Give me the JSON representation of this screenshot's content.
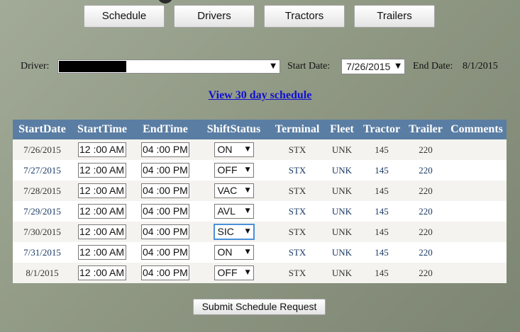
{
  "nav": {
    "buttons": [
      "Schedule",
      "Drivers",
      "Tractors",
      "Trailers"
    ]
  },
  "filters": {
    "driver_label": "Driver:",
    "driver_value": "",
    "start_label": "Start Date:",
    "start_value": "7/26/2015",
    "end_label": "End Date:",
    "end_value": "8/1/2015"
  },
  "link": "View 30 day schedule",
  "table": {
    "headers": [
      "StartDate",
      "StartTime",
      "EndTime",
      "ShiftStatus",
      "Terminal",
      "Fleet",
      "Tractor",
      "Trailer",
      "Comments"
    ],
    "rows": [
      {
        "date": "7/26/2015",
        "start": "12 :00 AM",
        "end": "04 :00 PM",
        "status": "ON",
        "terminal": "STX",
        "fleet": "UNK",
        "tractor": "145",
        "trailer": "220",
        "comments": ""
      },
      {
        "date": "7/27/2015",
        "start": "12 :00 AM",
        "end": "04 :00 PM",
        "status": "OFF",
        "terminal": "STX",
        "fleet": "UNK",
        "tractor": "145",
        "trailer": "220",
        "comments": ""
      },
      {
        "date": "7/28/2015",
        "start": "12 :00 AM",
        "end": "04 :00 PM",
        "status": "VAC",
        "terminal": "STX",
        "fleet": "UNK",
        "tractor": "145",
        "trailer": "220",
        "comments": ""
      },
      {
        "date": "7/29/2015",
        "start": "12 :00 AM",
        "end": "04 :00 PM",
        "status": "AVL",
        "terminal": "STX",
        "fleet": "UNK",
        "tractor": "145",
        "trailer": "220",
        "comments": ""
      },
      {
        "date": "7/30/2015",
        "start": "12 :00 AM",
        "end": "04 :00 PM",
        "status": "SIC",
        "terminal": "STX",
        "fleet": "UNK",
        "tractor": "145",
        "trailer": "220",
        "comments": ""
      },
      {
        "date": "7/31/2015",
        "start": "12 :00 AM",
        "end": "04 :00 PM",
        "status": "ON",
        "terminal": "STX",
        "fleet": "UNK",
        "tractor": "145",
        "trailer": "220",
        "comments": ""
      },
      {
        "date": "8/1/2015",
        "start": "12 :00 AM",
        "end": "04 :00 PM",
        "status": "OFF",
        "terminal": "STX",
        "fleet": "UNK",
        "tractor": "145",
        "trailer": "220",
        "comments": ""
      }
    ]
  },
  "submit": "Submit Schedule Request",
  "icons": {
    "dropdown": "triangle-down-icon"
  },
  "colors": {
    "header_bg": "#5a7da3",
    "link": "#1010d0",
    "odd_row": "#f5f3ef",
    "even_row": "#ffffff"
  }
}
